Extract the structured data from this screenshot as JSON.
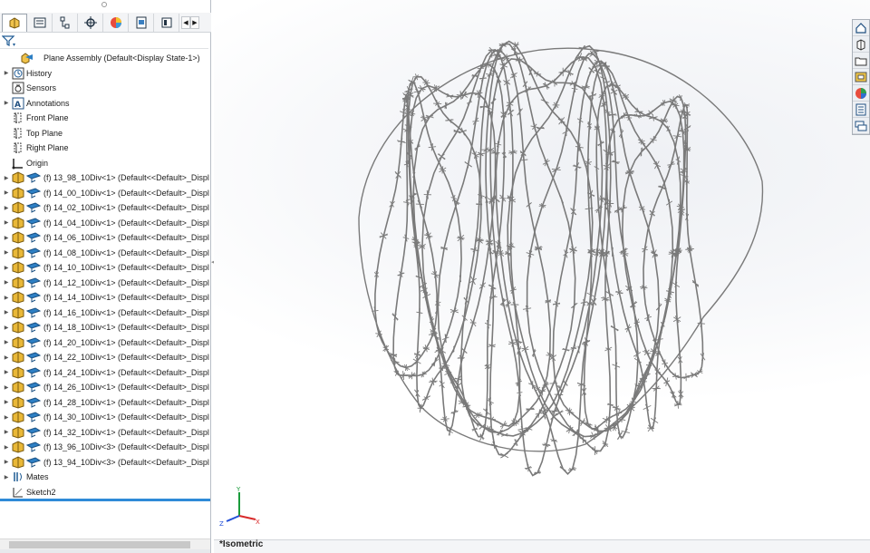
{
  "feature_tree": {
    "root": "Plane Assembly  (Default<Display State-1>)",
    "items": [
      {
        "label": "History",
        "icon": "history-icon",
        "expander": true
      },
      {
        "label": "Sensors",
        "icon": "sensors-icon",
        "expander": false
      },
      {
        "label": "Annotations",
        "icon": "annotations-icon",
        "expander": true
      },
      {
        "label": "Front Plane",
        "icon": "plane-icon",
        "expander": false
      },
      {
        "label": "Top Plane",
        "icon": "plane-icon",
        "expander": false
      },
      {
        "label": "Right Plane",
        "icon": "plane-icon",
        "expander": false
      },
      {
        "label": "Origin",
        "icon": "origin-icon",
        "expander": false
      }
    ],
    "components": [
      "(f) 13_98_10Div<1> (Default<<Default>_Displ",
      "(f) 14_00_10Div<1> (Default<<Default>_Displ",
      "(f) 14_02_10Div<1> (Default<<Default>_Displ",
      "(f) 14_04_10Div<1> (Default<<Default>_Displ",
      "(f) 14_06_10Div<1> (Default<<Default>_Displ",
      "(f) 14_08_10Div<1> (Default<<Default>_Displ",
      "(f) 14_10_10Div<1> (Default<<Default>_Displ",
      "(f) 14_12_10Div<1> (Default<<Default>_Displ",
      "(f) 14_14_10Div<1> (Default<<Default>_Displ",
      "(f) 14_16_10Div<1> (Default<<Default>_Displ",
      "(f) 14_18_10Div<1> (Default<<Default>_Displ",
      "(f) 14_20_10Div<1> (Default<<Default>_Displ",
      "(f) 14_22_10Div<1> (Default<<Default>_Displ",
      "(f) 14_24_10Div<1> (Default<<Default>_Displ",
      "(f) 14_26_10Div<1> (Default<<Default>_Displ",
      "(f) 14_28_10Div<1> (Default<<Default>_Displ",
      "(f) 14_30_10Div<1> (Default<<Default>_Displ",
      "(f) 14_32_10Div<1> (Default<<Default>_Displ",
      "(f) 13_96_10Div<3> (Default<<Default>_Displ",
      "(f) 13_94_10Div<3> (Default<<Default>_Displ"
    ],
    "footer_items": [
      {
        "label": "Mates",
        "icon": "mates-icon",
        "expander": true
      },
      {
        "label": "Sketch2",
        "icon": "sketch-icon",
        "expander": false
      }
    ]
  },
  "tabs": [
    {
      "name": "tab-feature-manager",
      "icon": "assembly-icon"
    },
    {
      "name": "tab-property-manager",
      "icon": "property-icon"
    },
    {
      "name": "tab-configuration-manager",
      "icon": "configuration-icon"
    },
    {
      "name": "tab-dimxpert",
      "icon": "dimxpert-icon"
    },
    {
      "name": "tab-display-manager",
      "icon": "display-manager-icon"
    },
    {
      "name": "tab-cam",
      "icon": "cam-icon"
    },
    {
      "name": "tab-extra",
      "icon": "extra-icon"
    }
  ],
  "graphics": {
    "view_name": "*Isometric",
    "triad": {
      "x": "X",
      "y": "Y",
      "z": "Z"
    },
    "view_toolbar": [
      "home-icon",
      "view-orientation-icon",
      "open-folder-icon",
      "appearances-icon",
      "color-wheel-icon",
      "properties-icon",
      "comments-icon"
    ],
    "model_color": "#7a7a7a"
  },
  "colors": {
    "accent": "#2f8bd8",
    "folder_yellow": "#e9b838",
    "assembly_blue": "#2d7fc4"
  }
}
